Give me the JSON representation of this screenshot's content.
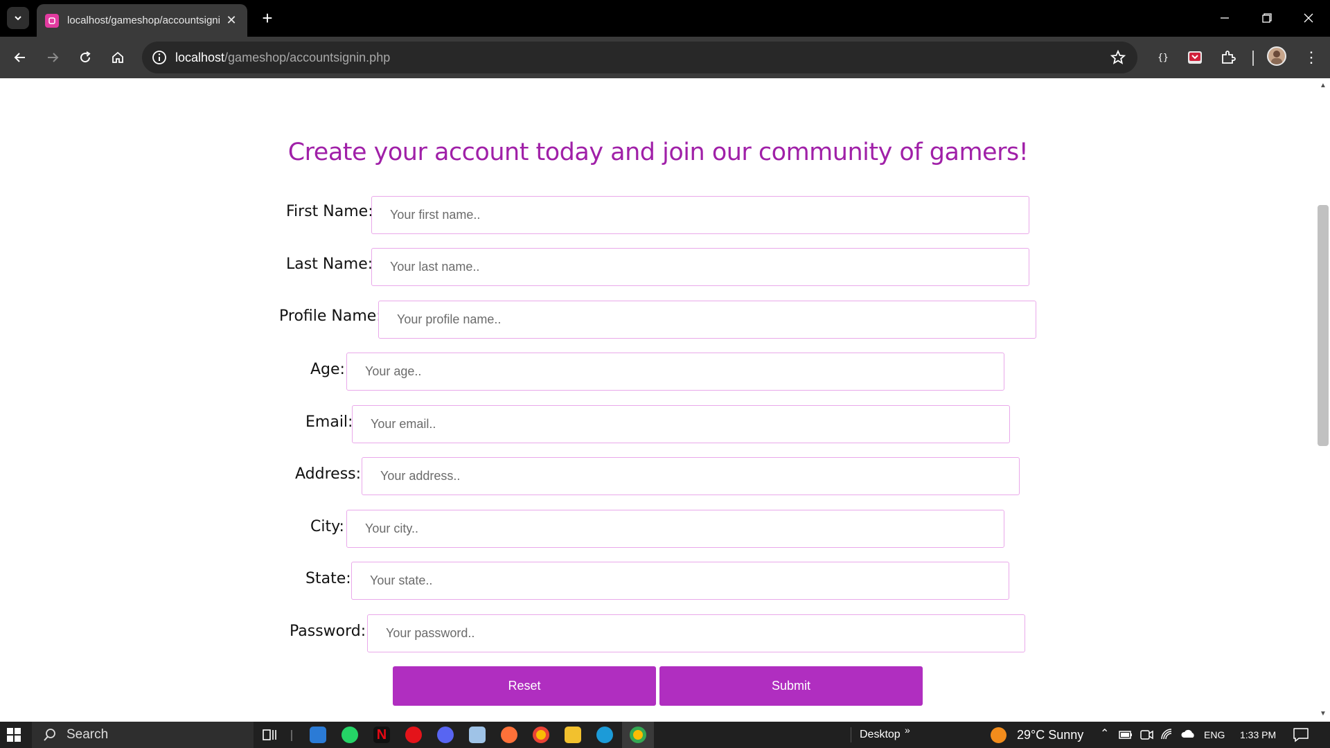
{
  "browser": {
    "tab_title": "localhost/gameshop/accountsignin",
    "url_host": "localhost",
    "url_path": "/gameshop/accountsignin.php"
  },
  "page": {
    "title": "Create your account today and join our community of gamers!",
    "fields": [
      {
        "label": "First Name:",
        "placeholder": "Your first name.."
      },
      {
        "label": "Last Name:",
        "placeholder": "Your last name.."
      },
      {
        "label": "Profile Name:",
        "placeholder": "Your profile name.."
      },
      {
        "label": "Age:",
        "placeholder": "Your age.."
      },
      {
        "label": "Email:",
        "placeholder": "Your email.."
      },
      {
        "label": "Address:",
        "placeholder": "Your address.."
      },
      {
        "label": "City:",
        "placeholder": "Your city.."
      },
      {
        "label": "State:",
        "placeholder": "Your state.."
      },
      {
        "label": "Password:",
        "placeholder": "Your password.."
      }
    ],
    "reset_label": "Reset",
    "submit_label": "Submit",
    "accent_color": "#b02ec0",
    "title_color": "#a020a8"
  },
  "taskbar": {
    "search_label": "Search",
    "desktop_label": "Desktop",
    "weather": "29°C  Sunny",
    "language": "ENG",
    "time": "1:33 PM"
  }
}
